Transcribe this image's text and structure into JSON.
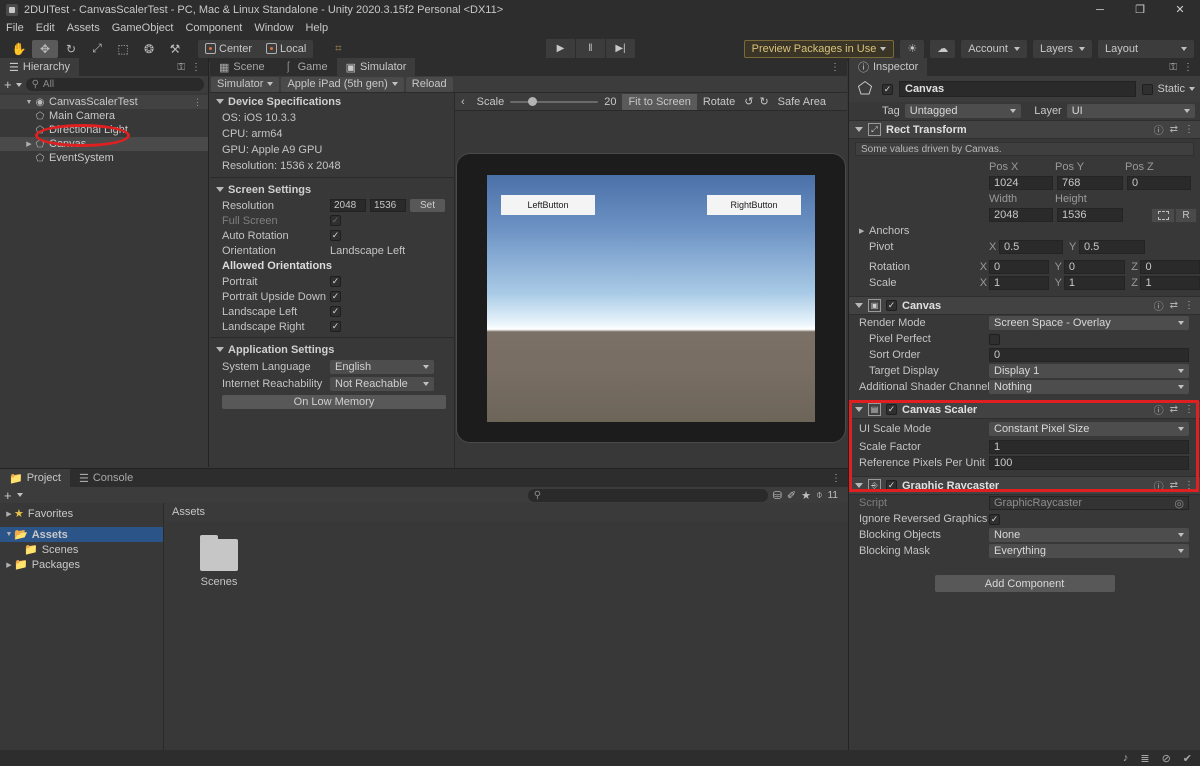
{
  "window": {
    "title": "2DUITest - CanvasScalerTest - PC, Mac & Linux Standalone - Unity 2020.3.15f2 Personal <DX11>",
    "minimize": "─",
    "maximize": "❐",
    "close": "✕"
  },
  "menu": [
    "File",
    "Edit",
    "Assets",
    "GameObject",
    "Component",
    "Window",
    "Help"
  ],
  "toolbar": {
    "tools": [
      {
        "name": "hand-tool",
        "glyph": "✋"
      },
      {
        "name": "move-tool",
        "glyph": "✥"
      },
      {
        "name": "rotate-tool",
        "glyph": "↻"
      },
      {
        "name": "scale-tool",
        "glyph": "⤢"
      },
      {
        "name": "rect-tool",
        "glyph": "⬚"
      },
      {
        "name": "transform-tool",
        "glyph": "❂"
      },
      {
        "name": "custom-tool",
        "glyph": "⚒"
      }
    ],
    "pivot": "Center",
    "space": "Local",
    "grid_glyph": "⌗",
    "play": "▶",
    "pause": "‖",
    "step": "▶|",
    "preview_packages": "Preview Packages in Use",
    "search_glyph": "☀",
    "cloud_glyph": "☁",
    "account": "Account",
    "layers": "Layers",
    "layout": "Layout"
  },
  "hierarchy": {
    "tab": "Hierarchy",
    "lock_glyph": "⚿",
    "menu_glyph": "⋮",
    "add_glyph": "+",
    "search_placeholder": "All",
    "search_glyph": "⚲",
    "items": [
      {
        "label": "CanvasScalerTest",
        "depth": 0,
        "icon": "scene-icon",
        "expanded": true,
        "selected": false,
        "root": true
      },
      {
        "label": "Main Camera",
        "depth": 1,
        "icon": "gameobject-icon",
        "expanded": false,
        "selected": false,
        "root": false
      },
      {
        "label": "Directional Light",
        "depth": 1,
        "icon": "gameobject-icon",
        "expanded": false,
        "selected": false,
        "root": false
      },
      {
        "label": "Canvas",
        "depth": 1,
        "icon": "gameobject-icon",
        "expanded": false,
        "selected": true,
        "root": false
      },
      {
        "label": "EventSystem",
        "depth": 1,
        "icon": "gameobject-icon",
        "expanded": false,
        "selected": false,
        "root": false
      }
    ]
  },
  "simulator": {
    "tabs": [
      {
        "label": "Scene",
        "icon": "grid-icon",
        "active": false
      },
      {
        "label": "Game",
        "icon": "gamepad-icon",
        "active": false
      },
      {
        "label": "Simulator",
        "icon": "device-icon",
        "active": true
      }
    ],
    "menu_glyph": "⋮",
    "mode": "Simulator",
    "device": "Apple iPad (5th gen)",
    "reload": "Reload",
    "device_specs": {
      "header": "Device Specifications",
      "os": "OS: iOS 10.3.3",
      "cpu": "CPU: arm64",
      "gpu": "GPU: Apple A9 GPU",
      "resolution": "Resolution: 1536 x 2048"
    },
    "screen_settings": {
      "header": "Screen Settings",
      "resolution_label": "Resolution",
      "resolution_w": "2048",
      "resolution_h": "1536",
      "set_button": "Set",
      "full_screen_label": "Full Screen",
      "full_screen_checked": true,
      "auto_rotation_label": "Auto Rotation",
      "auto_rotation_checked": true,
      "orientation_label": "Orientation",
      "orientation_value": "Landscape Left",
      "allowed_header": "Allowed Orientations",
      "allowed": [
        {
          "label": "Portrait",
          "checked": true
        },
        {
          "label": "Portrait Upside Down",
          "checked": true
        },
        {
          "label": "Landscape Left",
          "checked": true
        },
        {
          "label": "Landscape Right",
          "checked": true
        }
      ]
    },
    "application_settings": {
      "header": "Application Settings",
      "system_language_label": "System Language",
      "system_language_value": "English",
      "internet_label": "Internet Reachability",
      "internet_value": "Not Reachable",
      "low_memory_button": "On Low Memory"
    },
    "view_controls": {
      "back_glyph": "‹",
      "scale_label": "Scale",
      "scale_value": "20",
      "fit_to_screen": "Fit to Screen",
      "rotate_label": "Rotate",
      "rotate_ccw_glyph": "↺",
      "rotate_cw_glyph": "↻",
      "safe_area": "Safe Area"
    },
    "game_view": {
      "left_button": "LeftButton",
      "right_button": "RightButton"
    }
  },
  "inspector": {
    "tab": "Inspector",
    "tab_icon_glyph": "ⓘ",
    "lock_glyph": "⚿",
    "menu_glyph": "⋮",
    "object_name": "Canvas",
    "enabled": true,
    "static_label": "Static",
    "tag_label": "Tag",
    "tag_value": "Untagged",
    "layer_label": "Layer",
    "layer_value": "UI",
    "rect_transform": {
      "title": "Rect Transform",
      "info": "Some values driven by Canvas.",
      "col_pos_x": "Pos X",
      "col_pos_y": "Pos Y",
      "col_pos_z": "Pos Z",
      "pos_x": "1024",
      "pos_y": "768",
      "pos_z": "0",
      "col_width": "Width",
      "col_height": "Height",
      "width": "2048",
      "height": "1536",
      "r_button": "R",
      "anchors_label": "Anchors",
      "pivot_label": "Pivot",
      "pivot_x": "0.5",
      "pivot_y": "0.5",
      "rotation_label": "Rotation",
      "rot_x": "0",
      "rot_y": "0",
      "rot_z": "0",
      "scale_label": "Scale",
      "scale_x": "1",
      "scale_y": "1",
      "scale_z": "1",
      "axis_x": "X",
      "axis_y": "Y",
      "axis_z": "Z"
    },
    "canvas": {
      "title": "Canvas",
      "enabled": true,
      "render_mode_label": "Render Mode",
      "render_mode_value": "Screen Space - Overlay",
      "pixel_perfect_label": "Pixel Perfect",
      "pixel_perfect_checked": false,
      "sort_order_label": "Sort Order",
      "sort_order_value": "0",
      "target_display_label": "Target Display",
      "target_display_value": "Display 1",
      "shader_channels_label": "Additional Shader Channels",
      "shader_channels_value": "Nothing"
    },
    "canvas_scaler": {
      "title": "Canvas Scaler",
      "enabled": true,
      "ui_scale_mode_label": "UI Scale Mode",
      "ui_scale_mode_value": "Constant Pixel Size",
      "scale_factor_label": "Scale Factor",
      "scale_factor_value": "1",
      "ref_ppu_label": "Reference Pixels Per Unit",
      "ref_ppu_value": "100"
    },
    "graphic_raycaster": {
      "title": "Graphic Raycaster",
      "enabled": true,
      "script_label": "Script",
      "script_value": "GraphicRaycaster",
      "ignore_reversed_label": "Ignore Reversed Graphics",
      "ignore_reversed_checked": true,
      "blocking_objects_label": "Blocking Objects",
      "blocking_objects_value": "None",
      "blocking_mask_label": "Blocking Mask",
      "blocking_mask_value": "Everything"
    },
    "add_component": "Add Component"
  },
  "project": {
    "tabs": [
      {
        "label": "Project",
        "active": true,
        "icon": "folder-icon"
      },
      {
        "label": "Console",
        "active": false,
        "icon": "console-icon"
      }
    ],
    "menu_glyph": "⋮",
    "add_glyph": "+",
    "search_placeholder": "",
    "search_glyph": "⚲",
    "filter_icons": [
      {
        "name": "asset-filter-icon",
        "glyph": "⛁"
      },
      {
        "name": "label-filter-icon",
        "glyph": "✐"
      },
      {
        "name": "favorite-filter-icon",
        "glyph": "★"
      },
      {
        "name": "hidden-packages-icon",
        "glyph": "⌽"
      }
    ],
    "hidden_count": "11",
    "tree": [
      {
        "label": "Favorites",
        "depth": 0,
        "icon": "star-icon",
        "selected": false,
        "expandable": true
      },
      {
        "label": "Assets",
        "depth": 0,
        "icon": "folder-open-icon",
        "selected": true,
        "expandable": true
      },
      {
        "label": "Scenes",
        "depth": 1,
        "icon": "folder-icon",
        "selected": false,
        "expandable": false
      },
      {
        "label": "Packages",
        "depth": 0,
        "icon": "folder-icon",
        "selected": false,
        "expandable": true
      }
    ],
    "breadcrumb": "Assets",
    "items": [
      {
        "label": "Scenes",
        "type": "folder"
      }
    ]
  },
  "statusbar": {
    "icons": [
      {
        "name": "mute-audio-icon",
        "glyph": "♪"
      },
      {
        "name": "layers-icon",
        "glyph": "≣"
      },
      {
        "name": "no-preview-icon",
        "glyph": "⊘"
      },
      {
        "name": "ready-icon",
        "glyph": "✔"
      }
    ]
  },
  "annotations": {
    "accent_color": "#e02020",
    "ellipse_target": "Canvas hierarchy item",
    "rect_target": "Canvas Scaler component"
  }
}
